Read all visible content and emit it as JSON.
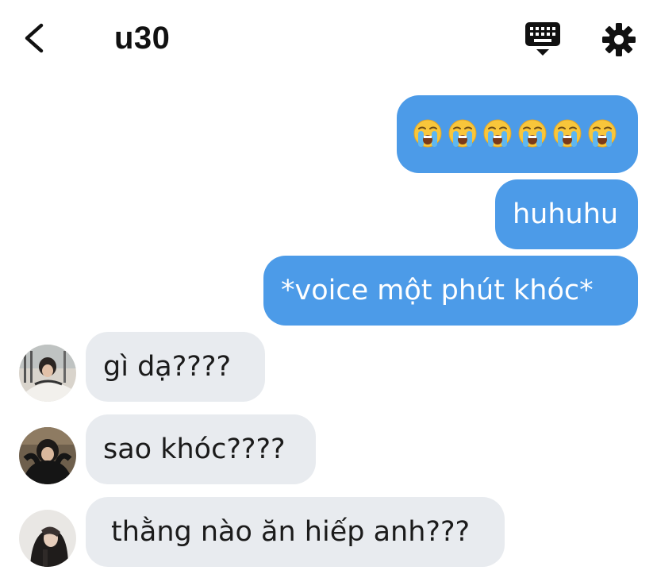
{
  "header": {
    "title": "u30",
    "back_icon": "chevron-left-icon",
    "keyboard_icon": "keyboard-icon",
    "settings_icon": "gear-icon"
  },
  "messages": [
    {
      "direction": "outgoing",
      "emoji": [
        "😭",
        "😭",
        "😭",
        "😭",
        "😭",
        "😭"
      ]
    },
    {
      "direction": "outgoing",
      "text": "huhuhu"
    },
    {
      "direction": "outgoing",
      "text": "*voice một phút khóc*"
    },
    {
      "direction": "incoming",
      "text": "gì dạ????"
    },
    {
      "direction": "incoming",
      "text": "sao khóc????"
    },
    {
      "direction": "incoming",
      "text": "thằng nào ăn hiếp anh???"
    }
  ],
  "colors": {
    "outgoing_bubble": "#4c9be8",
    "incoming_bubble": "#e8ebef",
    "text_dark": "#111111",
    "text_light": "#ffffff"
  }
}
